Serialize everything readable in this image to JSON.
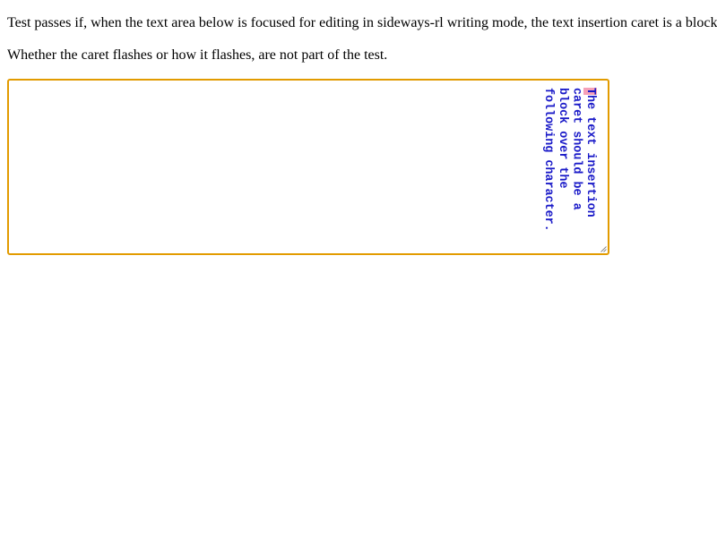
{
  "instructions": {
    "line1": "Test passes if, when the text area below is focused for editing in sideways-rl writing mode, the text insertion caret is a block.",
    "line2": "Whether the caret flashes or how it flashes, are not part of the test."
  },
  "textarea": {
    "caret_char": "T",
    "line1_rest": "he text insertion",
    "line2": "caret should be a",
    "line3": "block over the",
    "line4": "following character."
  },
  "colors": {
    "focus_border": "#e29b00",
    "text": "#1a1ac8",
    "caret_block": "#f5a0b8"
  }
}
